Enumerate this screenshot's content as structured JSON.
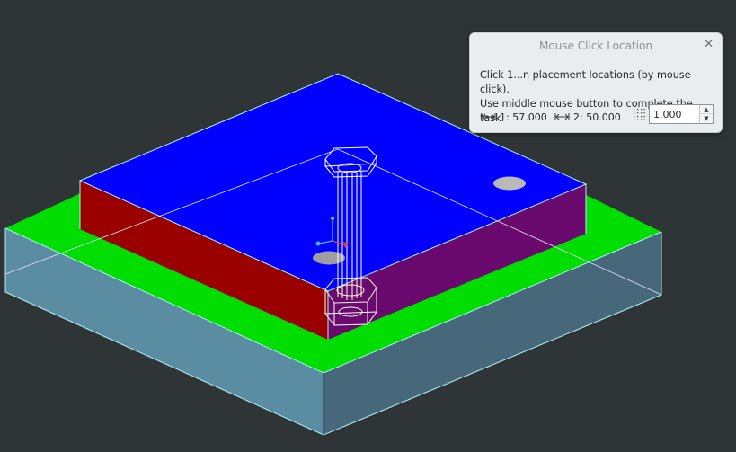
{
  "dialog": {
    "title": "Mouse Click Location",
    "close_icon": "close-icon",
    "message_line1": "Click 1...n placement locations (by mouse click).",
    "message_line2": "Use middle mouse button to complete the task.",
    "dim1_label": "1:",
    "dim1_value": "57.000",
    "dim2_label": "2:",
    "dim2_value": "50.000",
    "grid_value": "1.000",
    "spin_up": "▲",
    "spin_down": "▼"
  },
  "icons": {
    "dimension": "horizontal-dimension-icon",
    "grid": "grid-spacing-icon",
    "axis_triad": "coordinate-triad-icon"
  },
  "colors": {
    "background": "#2f3436",
    "top_face": "#0000ff",
    "left_face": "#9b0000",
    "right_face": "#6a0a6e",
    "base_top": "#00dd00",
    "base_left": "#5a8da1",
    "base_right": "#47687a",
    "edge_highlight": "#aef2f8"
  }
}
